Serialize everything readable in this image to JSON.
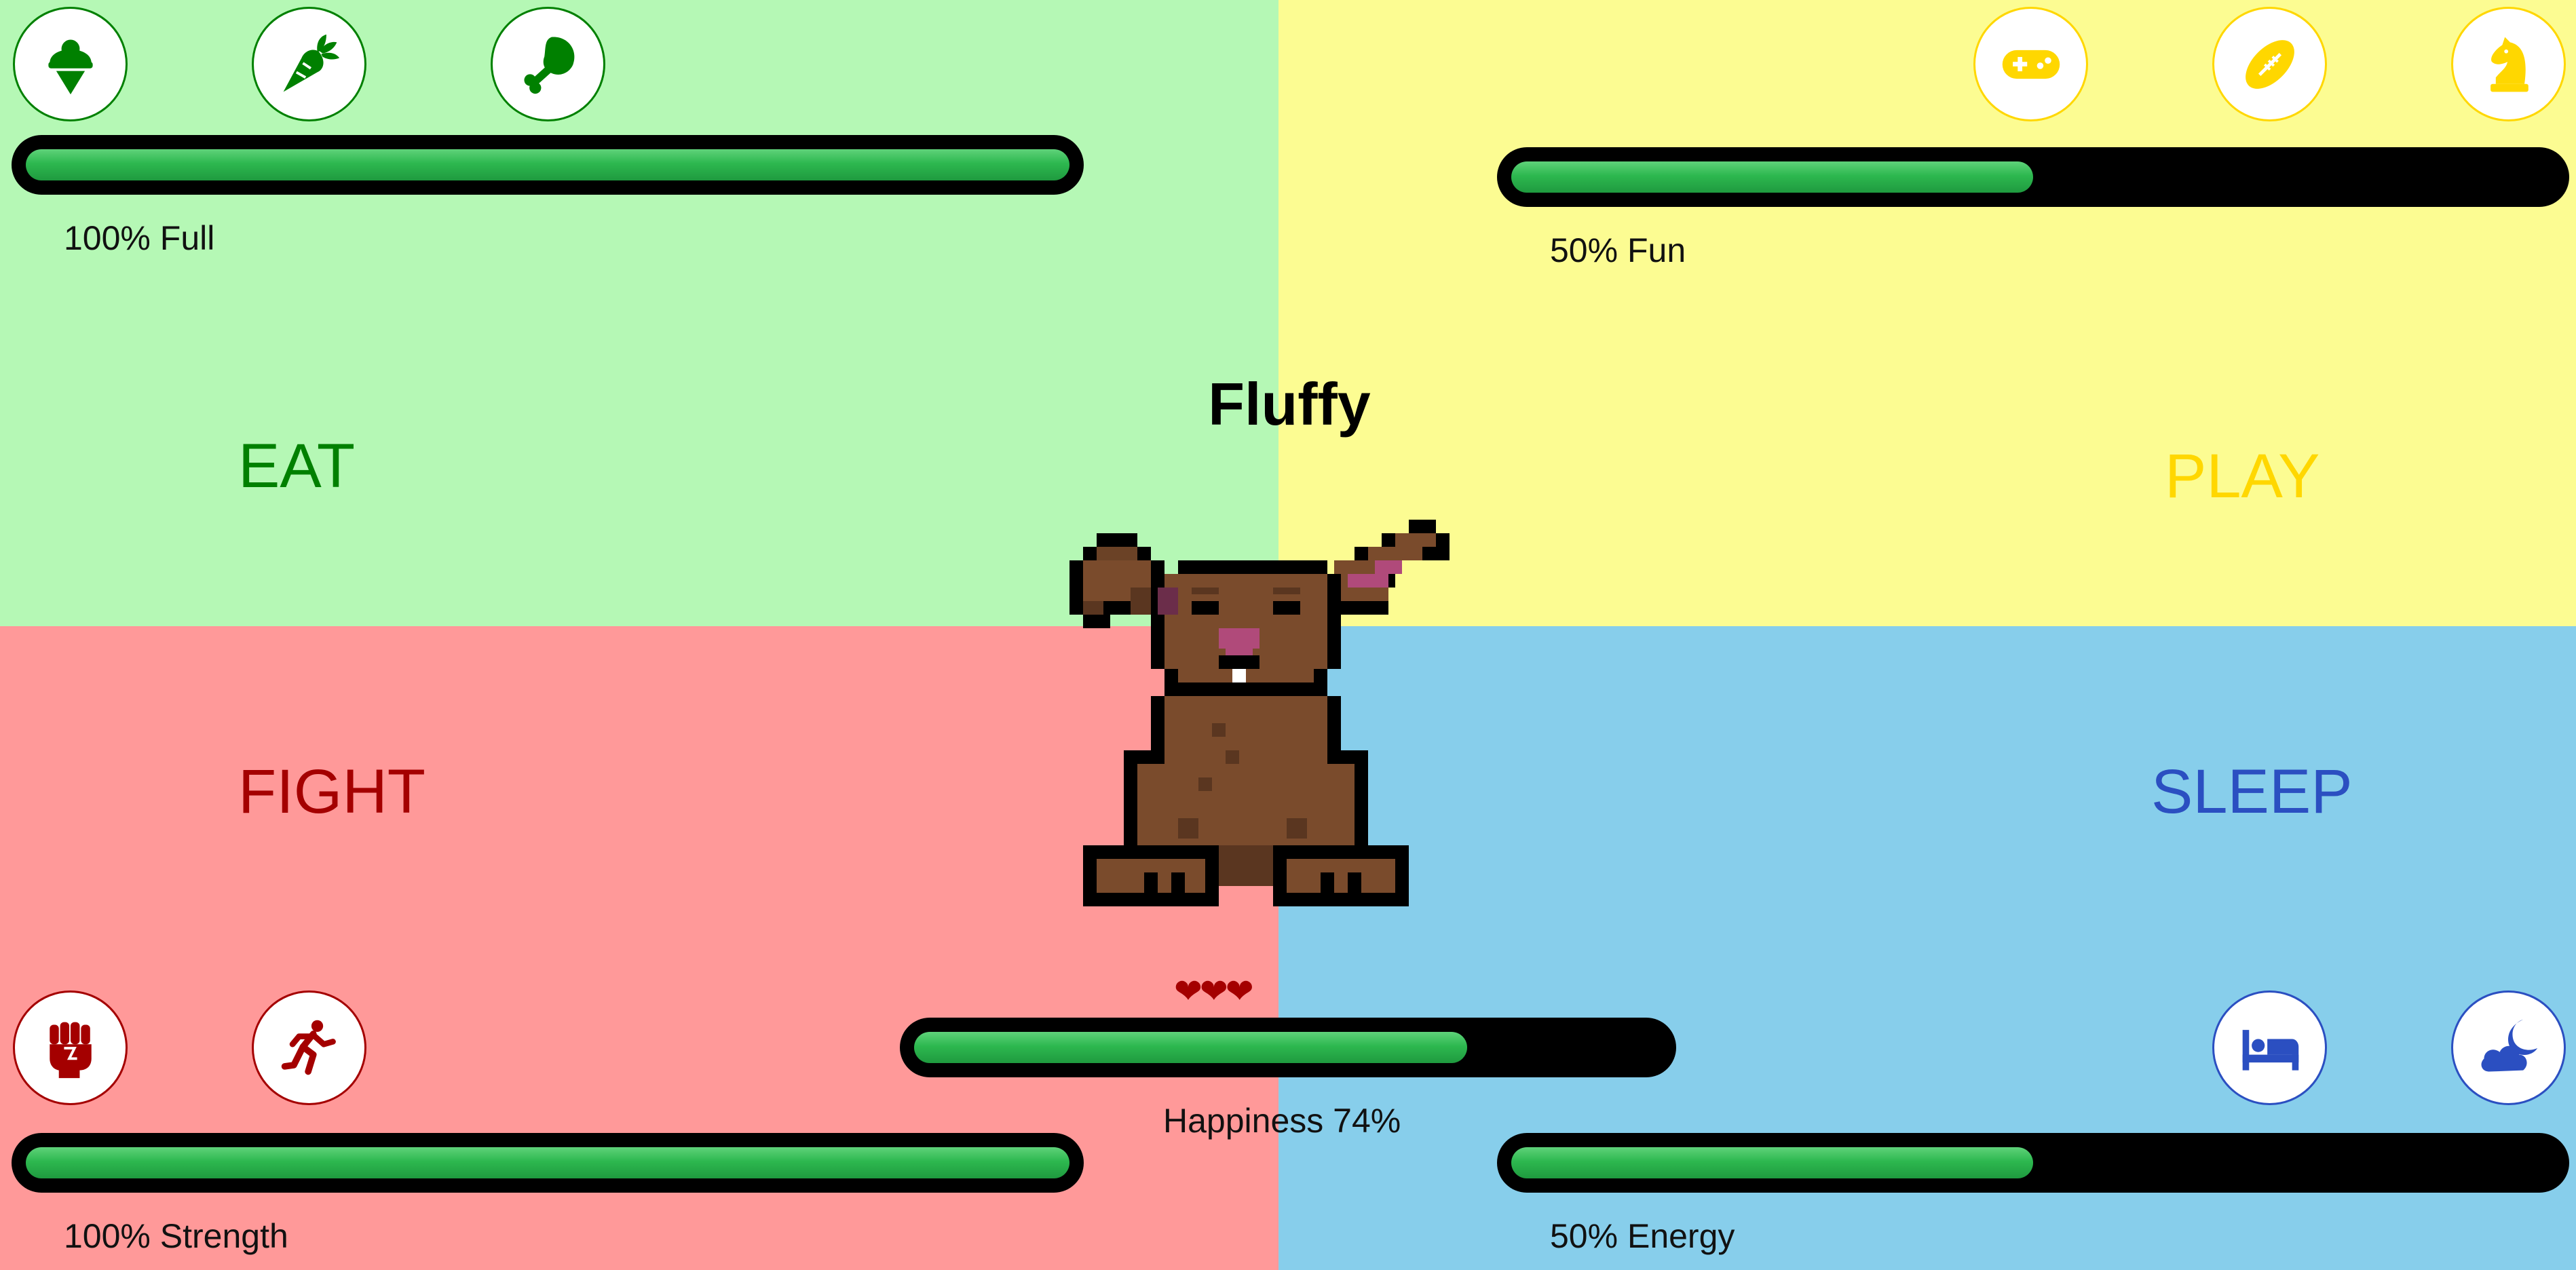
{
  "pet": {
    "name": "Fluffy"
  },
  "colors": {
    "eat_bg": "#b5f8b5",
    "play_bg": "#fcfc92",
    "fight_bg": "#ff9999",
    "sleep_bg": "#87ceeb",
    "eat_accent": "#008000",
    "play_accent": "#ffd700",
    "fight_accent": "#a40000",
    "sleep_accent": "#2b4fc1",
    "bar_fill": "#2db84f",
    "bar_track": "#000000"
  },
  "eat": {
    "label": "EAT",
    "icons": [
      "ice-cream-icon",
      "carrot-icon",
      "drumstick-icon"
    ],
    "value": 100,
    "stat_label": "100% Full"
  },
  "play": {
    "label": "PLAY",
    "icons": [
      "gamepad-icon",
      "football-icon",
      "chess-knight-icon"
    ],
    "value": 50,
    "stat_label": "50% Fun"
  },
  "fight": {
    "label": "FIGHT",
    "icons": [
      "fist-icon",
      "running-icon"
    ],
    "value": 100,
    "stat_label": "100% Strength"
  },
  "sleep": {
    "label": "SLEEP",
    "icons": [
      "bed-icon",
      "cloud-moon-icon"
    ],
    "value": 50,
    "stat_label": "50% Energy"
  },
  "happiness": {
    "hearts": "❤❤❤",
    "value": 74,
    "stat_label": "Happiness 74%"
  }
}
